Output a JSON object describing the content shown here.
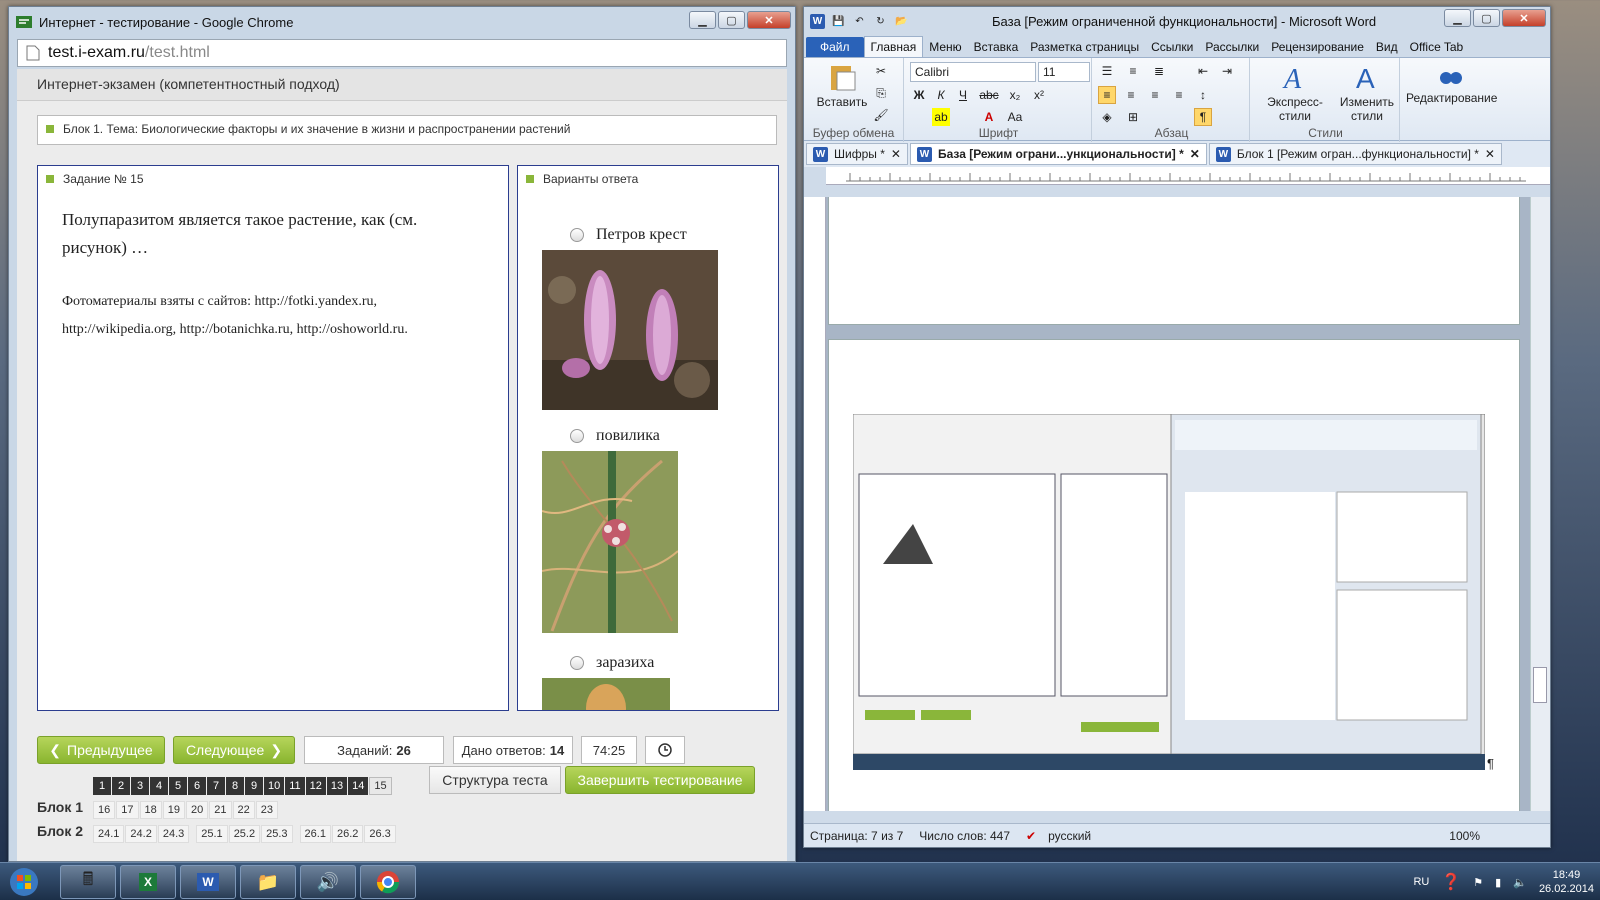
{
  "chrome": {
    "title": "Интернет - тестирование - Google Chrome",
    "address_host": "test.i-exam.ru",
    "address_path": "/test.html",
    "page_header": "Интернет-экзамен (компетентностный подход)",
    "block_topic": "Блок 1. Тема: Биологические факторы и их значение в жизни и распространении растений",
    "task_caption": "Задание № 15",
    "question": "Полупаразитом является такое растение, как (см. рисунок) …",
    "photo_note": "Фотоматериалы взяты с сайтов: http://fotki.yandex.ru, http://wikipedia.org, http://botanichka.ru, http://oshoworld.ru.",
    "answers_caption": "Варианты ответа",
    "options": [
      "Петров крест",
      "повилика",
      "заразиха"
    ],
    "prev_label": "Предыдущее",
    "next_label": "Следующее",
    "tasks_label": "Заданий:",
    "tasks_value": "26",
    "answered_label": "Дано ответов:",
    "answered_value": "14",
    "timer": "74:25",
    "structure_label": "Структура теста",
    "finish_label": "Завершить тестирование",
    "nav_numbers": [
      "1",
      "2",
      "3",
      "4",
      "5",
      "6",
      "7",
      "8",
      "9",
      "10",
      "11",
      "12",
      "13",
      "14",
      "15"
    ],
    "block1_label": "Блок 1",
    "block1_numbers": [
      "16",
      "17",
      "18",
      "19",
      "20",
      "21",
      "22",
      "23"
    ],
    "block2_label": "Блок 2",
    "block2_numbers": [
      "24.1",
      "24.2",
      "24.3",
      "25.1",
      "25.2",
      "25.3",
      "26.1",
      "26.2",
      "26.3"
    ]
  },
  "word": {
    "title": "База [Режим ограниченной функциональности] - Microsoft Word",
    "tabs": [
      "Файл",
      "Главная",
      "Меню",
      "Вставка",
      "Разметка страницы",
      "Ссылки",
      "Рассылки",
      "Рецензирование",
      "Вид",
      "Office Tab"
    ],
    "paste_label": "Вставить",
    "clipboard_group": "Буфер обмена",
    "font_name": "Calibri",
    "font_size": "11",
    "font_group": "Шрифт",
    "para_group": "Абзац",
    "express_styles": "Экспресс-стили",
    "change_styles": "Изменить стили",
    "styles_group": "Стили",
    "editing": "Редактирование",
    "doc_tabs": [
      "Шифры *",
      "База [Режим ограни...ункциональности] *",
      "Блок 1 [Режим огран...функциональности] *"
    ],
    "status_page": "Страница: 7 из 7",
    "status_words": "Число слов: 447",
    "status_lang": "русский",
    "zoom": "100%",
    "pilcrow": "¶"
  },
  "taskbar": {
    "lang": "RU",
    "time": "18:49",
    "date": "26.02.2014"
  },
  "colors": {
    "accent_green": "#8ab63a",
    "panel_border": "#2b3d8f",
    "word_blue": "#2a62b8"
  }
}
